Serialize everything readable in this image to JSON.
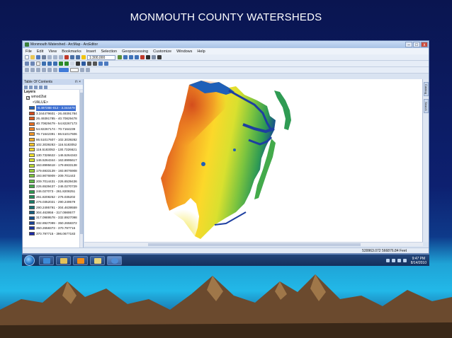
{
  "slide": {
    "title": "MONMOUTH COUNTY WATERSHEDS"
  },
  "window": {
    "title": "Monmouth Watershed - ArcMap - ArcEditor",
    "controls": {
      "minimize": "–",
      "maximize": "□",
      "close": "x"
    }
  },
  "menu": [
    "File",
    "Edit",
    "View",
    "Bookmarks",
    "Insert",
    "Selection",
    "Geoprocessing",
    "Customize",
    "Windows",
    "Help"
  ],
  "toolbar": {
    "scale": "1:300,000"
  },
  "toc": {
    "title": "Table Of Contents",
    "pin": "⊓ ×",
    "root": "Layers",
    "layer_name": "wmod2lat",
    "field": "<VALUE>",
    "classes": [
      {
        "label": "-8.49728E-012 - 3.344479",
        "color": "#1f5fb8"
      },
      {
        "label": "3.344479601 - 26.49391784",
        "color": "#d2491c"
      },
      {
        "label": "26.49391785 - 40.70829478",
        "color": "#de5b1e"
      },
      {
        "label": "40.70829479 - 54.82267173",
        "color": "#e66e21"
      },
      {
        "label": "54.82267174 - 70.7164239",
        "color": "#ef8223"
      },
      {
        "label": "70.71642391 - 86.51017606",
        "color": "#f59725"
      },
      {
        "label": "86.51017607 - 102.3039282",
        "color": "#f8ad26"
      },
      {
        "label": "102.3039283 - 116.5183052",
        "color": "#fbc427"
      },
      {
        "label": "116.5183053 - 130.7326621",
        "color": "#fcd82a"
      },
      {
        "label": "130.7326622 - 146.5264343",
        "color": "#f2e22c"
      },
      {
        "label": "146.5264344 - 163.8995617",
        "color": "#d9e02f"
      },
      {
        "label": "163.8995618 - 179.6933138",
        "color": "#bcd934"
      },
      {
        "label": "179.6933139 - 193.9076908",
        "color": "#9ccf39"
      },
      {
        "label": "193.9076909 - 209.701443",
        "color": "#7cc43f"
      },
      {
        "label": "209.7014431 - 226.6539436",
        "color": "#5db845"
      },
      {
        "label": "226.6539437 - 246.0270729",
        "color": "#43aa4b"
      },
      {
        "label": "246.027073 - 261.8208251",
        "color": "#2f9b53"
      },
      {
        "label": "261.8208252 - 276.035202",
        "color": "#228c5c"
      },
      {
        "label": "276.0352021 - 290.249579",
        "color": "#1a7d67"
      },
      {
        "label": "290.2495791 - 304.4639559",
        "color": "#176f73"
      },
      {
        "label": "304.463956 - 317.0989577",
        "color": "#165f7f"
      },
      {
        "label": "317.0989578 - 332.8927098",
        "color": "#17508b"
      },
      {
        "label": "332.8927099 - 350.2658372",
        "color": "#184297"
      },
      {
        "label": "350.2658373 - 370.797715",
        "color": "#1a35a0"
      },
      {
        "label": "370.797715 - 396.0677183",
        "color": "#1d2aa8"
      }
    ]
  },
  "dock": {
    "tab1": "Catalog",
    "tab2": "Search"
  },
  "status": {
    "coordinates": "539963.072  566876.84 Feet"
  },
  "taskbar": {
    "clock_time": "9:47 PM",
    "clock_date": "8/14/2010"
  }
}
